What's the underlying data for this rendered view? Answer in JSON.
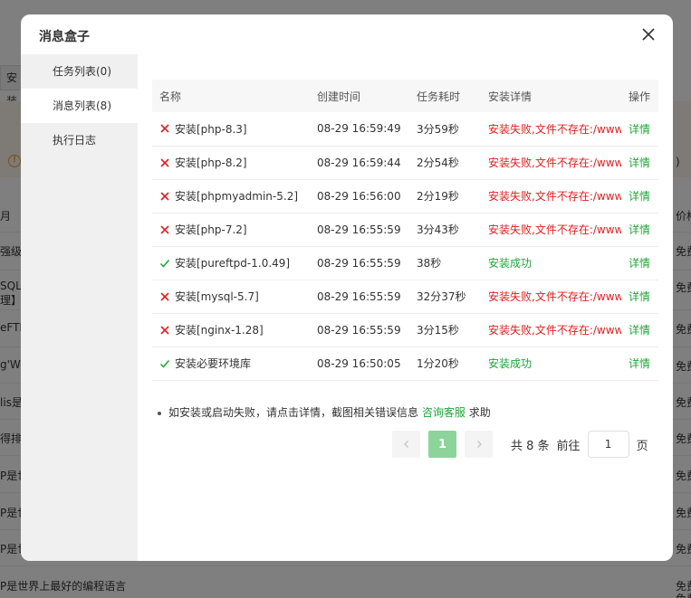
{
  "background": {
    "tab_label": "安装",
    "left_snippets": [
      "月",
      "强级，",
      "SQL",
      "理】搭",
      "eFTP",
      "g'We",
      "lis是",
      "得排名",
      "P是世",
      "P是世",
      "P是世",
      "P是世界上最好的编程语言"
    ],
    "right_snippets": [
      "价格",
      "免费",
      "免费",
      "免费",
      "免费",
      "免费",
      "免费",
      "免费",
      "免费",
      "免费",
      "免费",
      "免费"
    ],
    "warn_right": ")"
  },
  "dialog": {
    "title": "消息盒子",
    "close_icon": "close-icon"
  },
  "sidebar": {
    "items": [
      {
        "label": "任务列表(0)",
        "active": false
      },
      {
        "label": "消息列表(8)",
        "active": true
      },
      {
        "label": "执行日志",
        "active": false
      }
    ]
  },
  "table": {
    "headers": {
      "name": "名称",
      "created": "创建时间",
      "duration": "任务耗时",
      "detail": "安装详情",
      "action": "操作"
    },
    "rows": [
      {
        "status": "fail",
        "name": "安装[php-8.3]",
        "created": "08-29 16:59:49",
        "duration": "3分59秒",
        "detail": "安装失败,文件不存在:/www/server/panel/install/php.sh",
        "action": "详情"
      },
      {
        "status": "fail",
        "name": "安装[php-8.2]",
        "created": "08-29 16:59:44",
        "duration": "2分54秒",
        "detail": "安装失败,文件不存在:/www/server/panel/install/php.sh",
        "action": "详情"
      },
      {
        "status": "fail",
        "name": "安装[phpmyadmin-5.2]",
        "created": "08-29 16:56:00",
        "duration": "2分19秒",
        "detail": "安装失败,文件不存在:/www/server/panel/install/phpmyadmin.sh",
        "action": "详情"
      },
      {
        "status": "fail",
        "name": "安装[php-7.2]",
        "created": "08-29 16:55:59",
        "duration": "3分43秒",
        "detail": "安装失败,文件不存在:/www/server/panel/install/php.sh",
        "action": "详情"
      },
      {
        "status": "ok",
        "name": "安装[pureftpd-1.0.49]",
        "created": "08-29 16:55:59",
        "duration": "38秒",
        "detail": "安装成功",
        "action": "详情"
      },
      {
        "status": "fail",
        "name": "安装[mysql-5.7]",
        "created": "08-29 16:55:59",
        "duration": "32分37秒",
        "detail": "安装失败,文件不存在:/www/server/panel/install/mysql.sh",
        "action": "详情"
      },
      {
        "status": "fail",
        "name": "安装[nginx-1.28]",
        "created": "08-29 16:55:59",
        "duration": "3分15秒",
        "detail": "安装失败,文件不存在:/www/server/panel/install/nginx.sh",
        "action": "详情"
      },
      {
        "status": "ok",
        "name": "安装必要环境库",
        "created": "08-29 16:50:05",
        "duration": "1分20秒",
        "detail": "安装成功",
        "action": "详情"
      }
    ]
  },
  "note": {
    "prefix": "如安装或启动失败，请点击详情，截图相关错误信息",
    "link": "咨询客服",
    "suffix": "求助"
  },
  "pagination": {
    "current_page": "1",
    "total_text": "共 8 条",
    "goto_label": "前往",
    "goto_value": "1",
    "page_unit": "页",
    "prev_icon": "chevron-left-icon",
    "next_icon": "chevron-right-icon"
  },
  "colors": {
    "accent": "#20a53a",
    "error": "#e02020",
    "page_active": "#8cd49a"
  }
}
